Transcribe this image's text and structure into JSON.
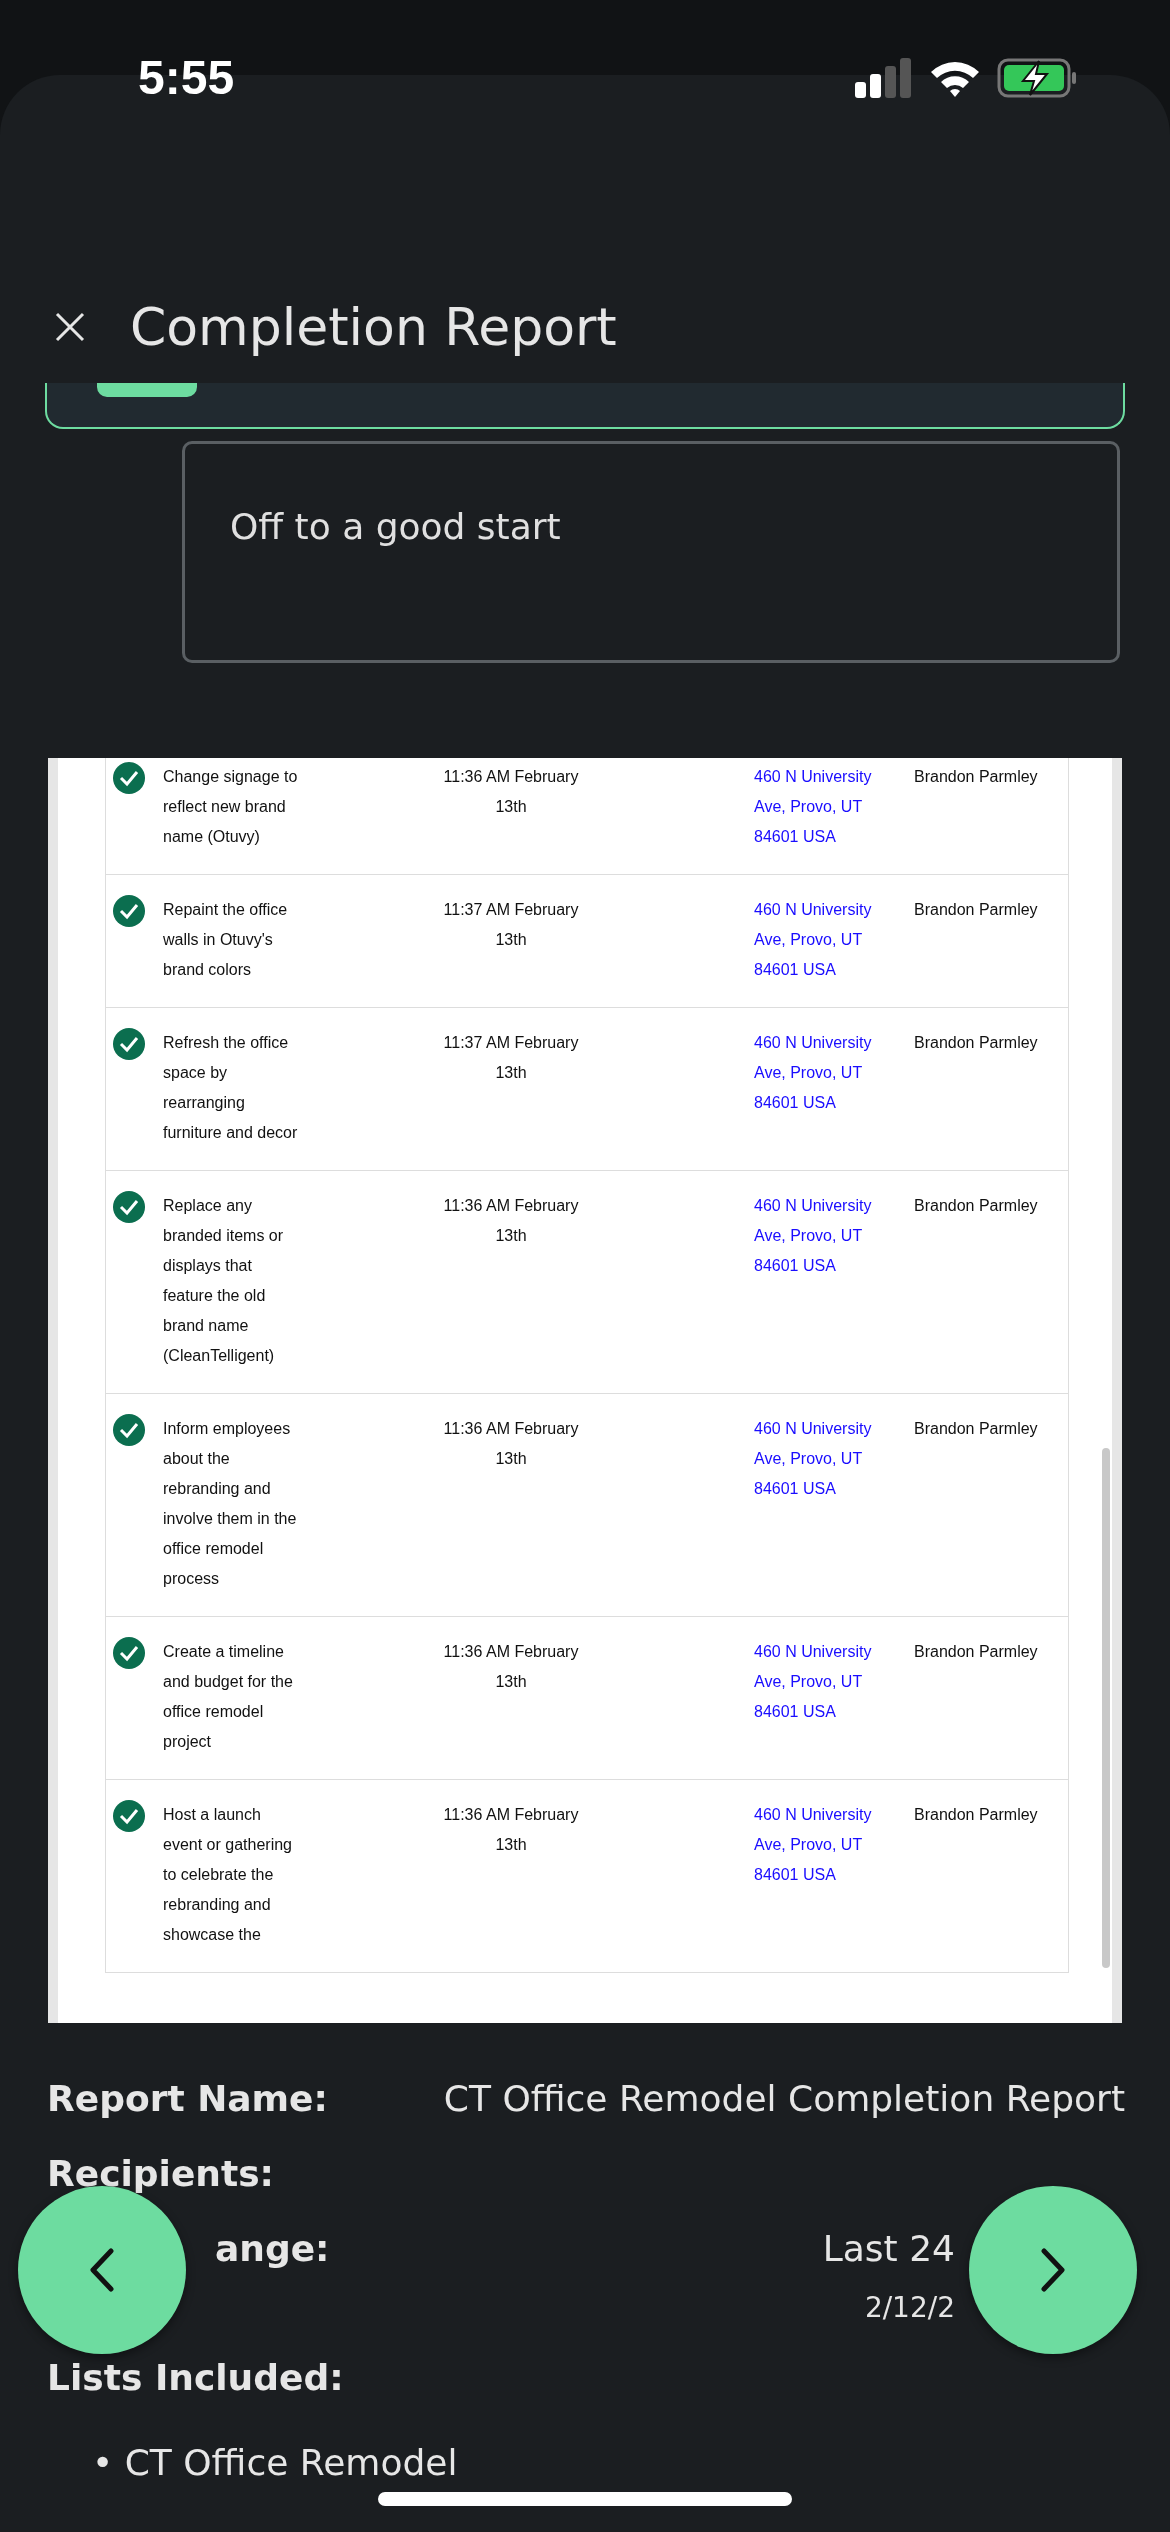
{
  "status_bar": {
    "time": "5:55"
  },
  "header": {
    "title": "Completion Report"
  },
  "note": {
    "value": "Off to a good start"
  },
  "table": {
    "rows": [
      {
        "checked": true,
        "task": "Change signage to reflect new brand name (Otuvy)",
        "time": "11:36 AM February 13th",
        "address": "460 N University Ave, Provo, UT 84601 USA",
        "user": "Brandon Parmley"
      },
      {
        "checked": true,
        "task": "Repaint the office walls in Otuvy's brand colors",
        "time": "11:37 AM February 13th",
        "address": "460 N University Ave, Provo, UT 84601 USA",
        "user": "Brandon Parmley"
      },
      {
        "checked": true,
        "task": "Refresh the office space by rearranging furniture and decor",
        "time": "11:37 AM February 13th",
        "address": "460 N University Ave, Provo, UT 84601 USA",
        "user": "Brandon Parmley"
      },
      {
        "checked": true,
        "task": "Replace any branded items or displays that feature the old brand name (CleanTelligent)",
        "time": "11:36 AM February 13th",
        "address": "460 N University Ave, Provo, UT 84601 USA",
        "user": "Brandon Parmley"
      },
      {
        "checked": true,
        "task": "Inform employees about the rebranding and involve them in the office remodel process",
        "time": "11:36 AM February 13th",
        "address": "460 N University Ave, Provo, UT 84601 USA",
        "user": "Brandon Parmley"
      },
      {
        "checked": true,
        "task": "Create a timeline and budget for the office remodel project",
        "time": "11:36 AM February 13th",
        "address": "460 N University Ave, Provo, UT 84601 USA",
        "user": "Brandon Parmley"
      },
      {
        "checked": true,
        "task": "Host a launch event or gathering to celebrate the rebranding and showcase the",
        "time": "11:36 AM February 13th",
        "address": "460 N University Ave, Provo, UT 84601 USA",
        "user": "Brandon Parmley"
      }
    ]
  },
  "summary": {
    "fields": [
      {
        "kind": "plain",
        "label": "Report Name:",
        "value": "CT Office Remodel Completion Report"
      },
      {
        "kind": "plain",
        "label": "Recipients:"
      },
      {
        "kind": "covered",
        "label": "ange:",
        "value": "Last 24",
        "sub": "2/12/2"
      },
      {
        "kind": "plain",
        "label": "Lists Included:"
      }
    ],
    "lists": [
      "• CT Office Remodel"
    ]
  }
}
